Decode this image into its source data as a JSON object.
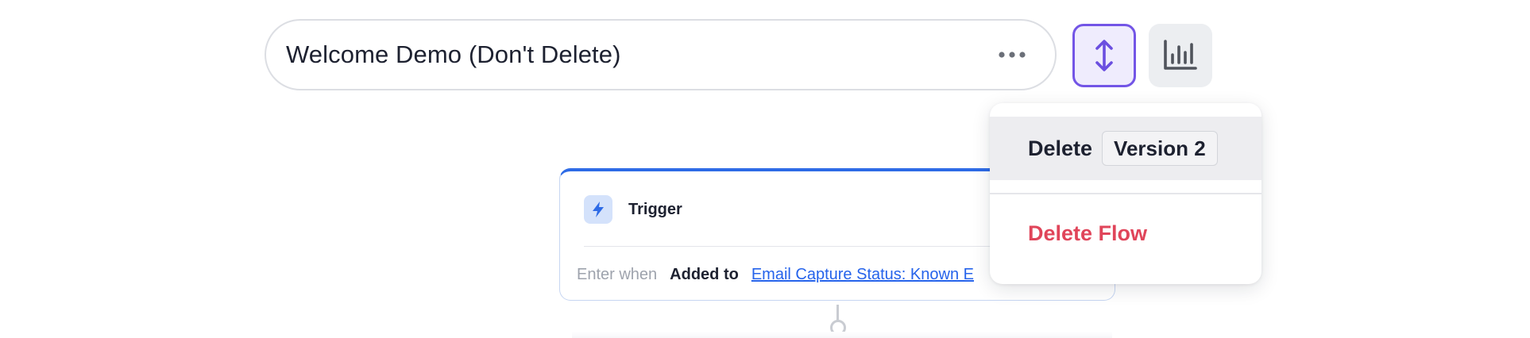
{
  "header": {
    "flow_name": "Welcome Demo (Don't Delete)",
    "more_icon": "ellipsis-horizontal-icon",
    "reorder_icon": "arrows-up-down-icon",
    "analytics_icon": "bar-chart-icon"
  },
  "trigger": {
    "icon": "lightning-bolt-icon",
    "title": "Trigger",
    "enter_when": "Enter when",
    "condition": "Added to",
    "list_link": "Email Capture Status: Known E"
  },
  "menu": {
    "delete_label": "Delete",
    "version_label": "Version 2",
    "delete_flow_label": "Delete Flow"
  },
  "colors": {
    "accent": "#7355e6",
    "trigger_blue": "#2e6be6",
    "danger": "#e0455a",
    "link": "#2563eb"
  }
}
